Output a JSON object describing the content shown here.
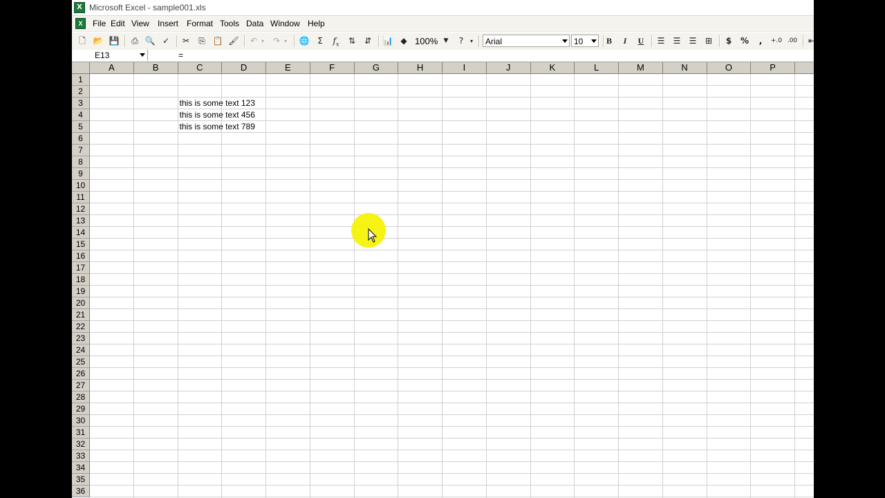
{
  "window": {
    "title": "Microsoft Excel - sample001.xls"
  },
  "menu": [
    {
      "label": "File"
    },
    {
      "label": "Edit"
    },
    {
      "label": "View"
    },
    {
      "label": "Insert"
    },
    {
      "label": "Format"
    },
    {
      "label": "Tools"
    },
    {
      "label": "Data"
    },
    {
      "label": "Window"
    },
    {
      "label": "Help"
    }
  ],
  "toolbar": {
    "zoom": "100%",
    "font_name": "Arial",
    "font_size": "10",
    "bold": "B",
    "italic": "I",
    "underline": "U",
    "currency": "$",
    "percent": "%",
    "comma": ",",
    "autosum": "Σ",
    "function": "f",
    "function_sub": "x"
  },
  "formula_bar": {
    "name_box": "E13",
    "equals": "=",
    "content": ""
  },
  "grid": {
    "columns": [
      "A",
      "B",
      "C",
      "D",
      "E",
      "F",
      "G",
      "H",
      "I",
      "J",
      "K",
      "L",
      "M",
      "N",
      "O",
      "P"
    ],
    "rows": [
      "1",
      "2",
      "3",
      "4",
      "5",
      "6",
      "7",
      "8",
      "9",
      "10",
      "11",
      "12",
      "13",
      "14",
      "15",
      "16",
      "17",
      "18",
      "19",
      "20",
      "21",
      "22",
      "23",
      "24",
      "25",
      "26",
      "27",
      "28",
      "29",
      "30",
      "31",
      "32",
      "33",
      "34",
      "35",
      "36"
    ],
    "cells": [
      {
        "ref": "C3",
        "value": "this is some text 123"
      },
      {
        "ref": "C4",
        "value": "this is some text 456"
      },
      {
        "ref": "C5",
        "value": "this is some text 789"
      }
    ]
  },
  "colors": {
    "highlight": "#f6f200",
    "header_bg": "#d4d0c8",
    "excel_green": "#1c7a3a"
  }
}
